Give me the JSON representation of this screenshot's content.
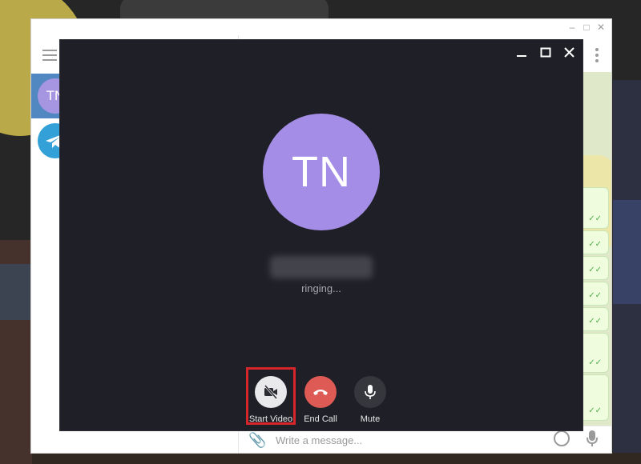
{
  "call": {
    "avatar_initials": "TN",
    "status": "ringing...",
    "buttons": {
      "start_video": "Start Video",
      "end_call": "End Call",
      "mute": "Mute"
    }
  },
  "sidebar": {
    "active_chat_initials": "TN"
  },
  "composer": {
    "placeholder": "Write a message..."
  },
  "colors": {
    "avatar": "#a48de6",
    "call_bg": "#1f2027",
    "end_call": "#de5a55",
    "highlight": "#d6262b",
    "sidebar_active": "#5288c1"
  },
  "icons": [
    "menu-icon",
    "telegram-icon",
    "more-icon",
    "video-off-icon",
    "phone-end-icon",
    "microphone-icon",
    "paperclip-icon",
    "emoji-icon",
    "minimize-icon",
    "maximize-icon",
    "close-icon"
  ]
}
